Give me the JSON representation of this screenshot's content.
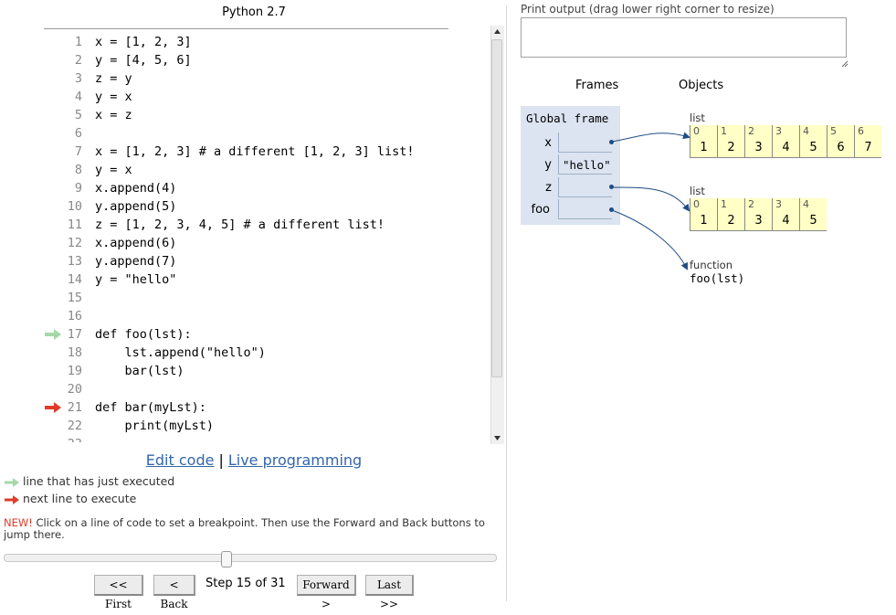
{
  "code_panel": {
    "language": "Python 2.7",
    "lines": [
      {
        "n": "1",
        "code": "x = [1, 2, 3]",
        "marker": ""
      },
      {
        "n": "2",
        "code": "y = [4, 5, 6]",
        "marker": ""
      },
      {
        "n": "3",
        "code": "z = y",
        "marker": ""
      },
      {
        "n": "4",
        "code": "y = x",
        "marker": ""
      },
      {
        "n": "5",
        "code": "x = z",
        "marker": ""
      },
      {
        "n": "6",
        "code": "",
        "marker": ""
      },
      {
        "n": "7",
        "code": "x = [1, 2, 3] # a different [1, 2, 3] list!",
        "marker": ""
      },
      {
        "n": "8",
        "code": "y = x",
        "marker": ""
      },
      {
        "n": "9",
        "code": "x.append(4)",
        "marker": ""
      },
      {
        "n": "10",
        "code": "y.append(5)",
        "marker": ""
      },
      {
        "n": "11",
        "code": "z = [1, 2, 3, 4, 5] # a different list!",
        "marker": ""
      },
      {
        "n": "12",
        "code": "x.append(6)",
        "marker": ""
      },
      {
        "n": "13",
        "code": "y.append(7)",
        "marker": ""
      },
      {
        "n": "14",
        "code": "y = \"hello\"",
        "marker": ""
      },
      {
        "n": "15",
        "code": "",
        "marker": ""
      },
      {
        "n": "16",
        "code": "",
        "marker": ""
      },
      {
        "n": "17",
        "code": "def foo(lst):",
        "marker": "executed"
      },
      {
        "n": "18",
        "code": "    lst.append(\"hello\")",
        "marker": ""
      },
      {
        "n": "19",
        "code": "    bar(lst)",
        "marker": ""
      },
      {
        "n": "20",
        "code": "",
        "marker": ""
      },
      {
        "n": "21",
        "code": "def bar(myLst):",
        "marker": "next"
      },
      {
        "n": "22",
        "code": "    print(myLst)",
        "marker": ""
      },
      {
        "n": "23",
        "code": "",
        "marker": ""
      }
    ],
    "edit_code_link": "Edit code",
    "separator": "|",
    "live_programming_link": "Live programming"
  },
  "legend": {
    "executed": "line that has just executed",
    "next": "next line to execute"
  },
  "notice": {
    "new_tag": "NEW!",
    "text": " Click on a line of code to set a breakpoint. Then use the Forward and Back buttons to jump there."
  },
  "navigation": {
    "progress": 0.45,
    "first": "<< First",
    "back": "< Back",
    "step_text": "Step 15 of 31",
    "forward": "Forward >",
    "last": "Last >>"
  },
  "output": {
    "label": "Print output (drag lower right corner to resize)",
    "content": ""
  },
  "visualization": {
    "frames_header": "Frames",
    "objects_header": "Objects",
    "global_frame": {
      "title": "Global frame",
      "variables": [
        {
          "name": "x",
          "value": ""
        },
        {
          "name": "y",
          "value": "\"hello\""
        },
        {
          "name": "z",
          "value": ""
        },
        {
          "name": "foo",
          "value": ""
        }
      ]
    },
    "objects": {
      "list1": {
        "type": "list",
        "indices": [
          "0",
          "1",
          "2",
          "3",
          "4",
          "5",
          "6"
        ],
        "values": [
          "1",
          "2",
          "3",
          "4",
          "5",
          "6",
          "7"
        ]
      },
      "list2": {
        "type": "list",
        "indices": [
          "0",
          "1",
          "2",
          "3",
          "4"
        ],
        "values": [
          "1",
          "2",
          "3",
          "4",
          "5"
        ]
      },
      "function": {
        "type": "function",
        "signature": "foo(lst)"
      }
    }
  },
  "colors": {
    "executed_arrow": "#a5d8a8",
    "next_arrow": "#e13b2a",
    "frame_bg": "#dbe4f0",
    "list_bg": "#ffffc6",
    "pointer": "#1e4d82"
  }
}
